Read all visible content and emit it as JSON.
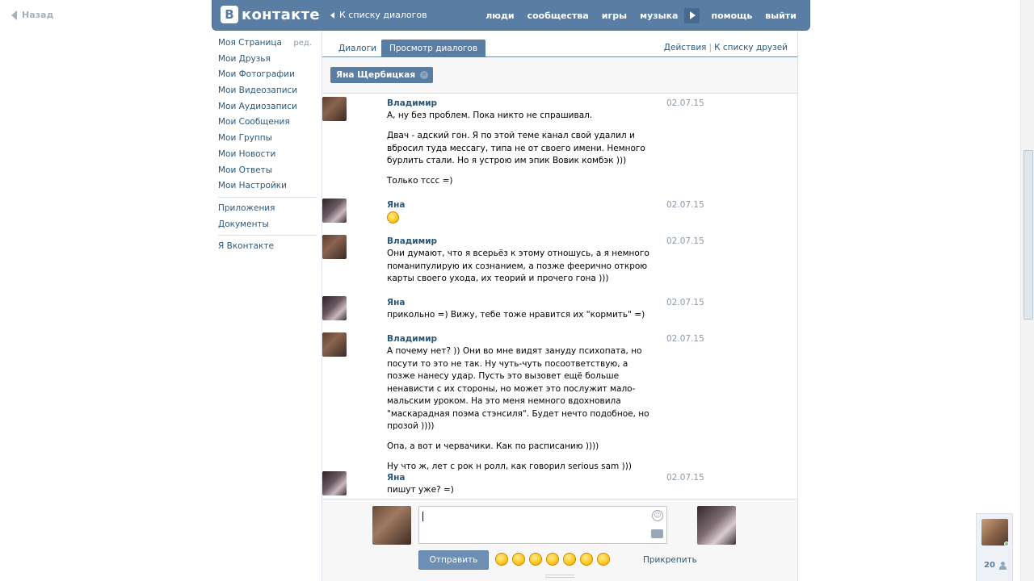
{
  "back": {
    "label": "Назад"
  },
  "header": {
    "logo_letter": "В",
    "logo_text": "контакте",
    "to_list": "К списку диалогов",
    "nav": [
      "люди",
      "сообщества",
      "игры",
      "музыка",
      "помощь",
      "выйти"
    ]
  },
  "menu": {
    "edit": "ред.",
    "items": [
      "Моя Страница",
      "Мои Друзья",
      "Мои Фотографии",
      "Мои Видеозаписи",
      "Мои Аудиозаписи",
      "Мои Сообщения",
      "Мои Группы",
      "Мои Новости",
      "Мои Ответы",
      "Мои Настройки"
    ],
    "items2": [
      "Приложения",
      "Документы"
    ],
    "items3": [
      "Я Вконтакте"
    ]
  },
  "tabs": {
    "dialogs": "Диалоги",
    "view": "Просмотр диалогов"
  },
  "actions": {
    "actions": "Действия",
    "friends": "К списку друзей"
  },
  "filter": {
    "chip": "Яна Щербицкая"
  },
  "messages": [
    {
      "author": "Владимир",
      "date": "02.07.15",
      "texts": [
        "А, ну без проблем. Пока никто не спрашивал.",
        "Двач - адский гон. Я по этой теме канал свой удалил и вбросил туда мессагу, типа не от своего имени. Немного бурлить стали. Но я устрою им эпик Вовик комбэк )))",
        "Только тссс =)"
      ]
    },
    {
      "author": "Яна",
      "date": "02.07.15",
      "texts": []
    },
    {
      "author": "Владимир",
      "date": "02.07.15",
      "texts": [
        "Они думают, что я всерьёз к этому отношусь, а я немного поманипулирую их сознанием, а позже феерично открою карты своего ухода, их теорий и прочего гона )))"
      ]
    },
    {
      "author": "Яна",
      "date": "02.07.15",
      "texts": [
        "прикольно =) Вижу, тебе тоже нравится их \"кормить\" =)"
      ]
    },
    {
      "author": "Владимир",
      "date": "02.07.15",
      "texts": [
        "А почему нет? )) Они во мне видят зануду психопата, но посути то это не так. Ну чуть-чуть посоответствую, а позже нанесу удар. Пусть это вызовет ещё больше ненависти с их стороны, но может это послужит мало-мальским уроком. На это меня немного вдохновила \"маскарадная поэма стэнсиля\". Будет нечто подобное, но прозой ))))",
        "Опа, а вот и червачики. Как по расписанию ))))",
        "Ну что ж, лет с рок н ролл, как говорил serious sam )))"
      ]
    },
    {
      "author": "Яна",
      "date": "02.07.15",
      "texts": [
        "пишут уже? =)"
      ]
    }
  ],
  "composer": {
    "send": "Отправить",
    "attach": "Прикрепить"
  },
  "friends_widget": {
    "count": "20"
  }
}
